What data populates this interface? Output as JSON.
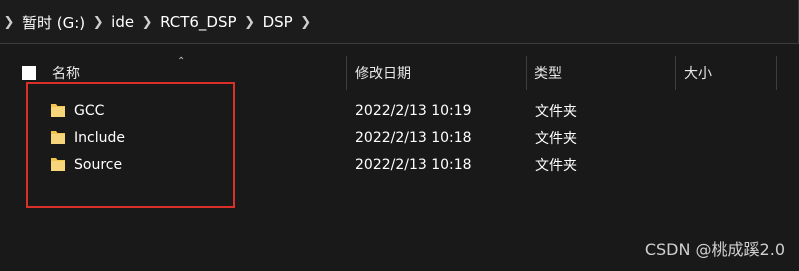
{
  "address": {
    "segments": [
      "暂时 (G:)",
      "ide",
      "RCT6_DSP",
      "DSP"
    ]
  },
  "columns": {
    "name": "名称",
    "modified": "修改日期",
    "type": "类型",
    "size": "大小"
  },
  "rows": [
    {
      "name": "GCC",
      "modified": "2022/2/13 10:19",
      "type": "文件夹"
    },
    {
      "name": "Include",
      "modified": "2022/2/13 10:18",
      "type": "文件夹"
    },
    {
      "name": "Source",
      "modified": "2022/2/13 10:18",
      "type": "文件夹"
    }
  ],
  "watermark": "CSDN @桃成蹊2.0",
  "colors": {
    "annotation_border": "#d9302a",
    "folder": "#f2c54f",
    "background": "#191919"
  }
}
